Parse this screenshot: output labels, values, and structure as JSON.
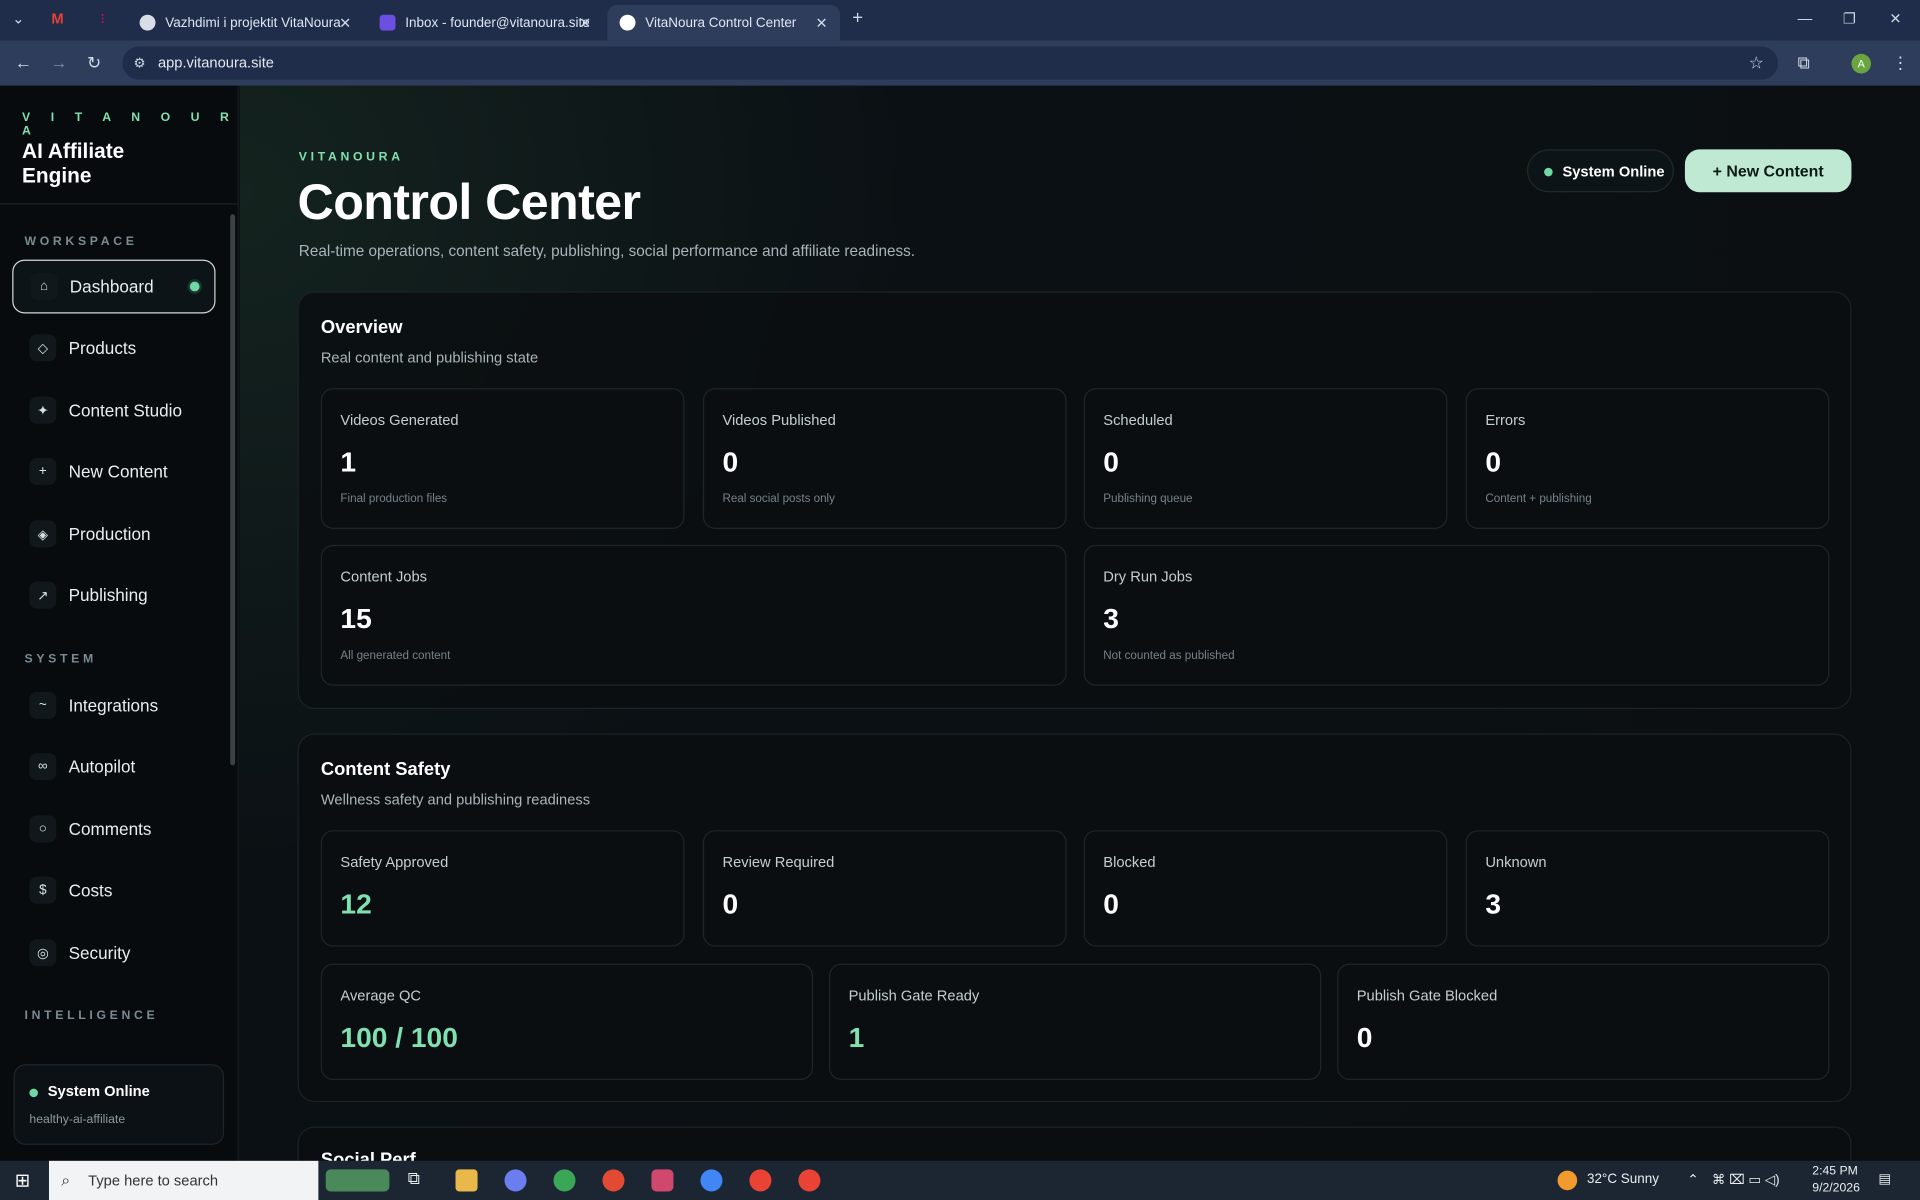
{
  "browser": {
    "tabs": [
      {
        "label": "Vazhdimi i projektit VitaNoura"
      },
      {
        "label": "Inbox - founder@vitanoura.site"
      },
      {
        "label": "VitaNoura Control Center"
      }
    ],
    "url": "app.vitanoura.site"
  },
  "sidebar": {
    "brand_small": "V I T A N O U R A",
    "brand_big": "AI Affiliate Engine",
    "section_workspace": "WORKSPACE",
    "section_system": "SYSTEM",
    "section_intelligence": "INTELLIGENCE",
    "workspace_items": [
      {
        "label": "Dashboard",
        "icon": "⌂"
      },
      {
        "label": "Products",
        "icon": "◇"
      },
      {
        "label": "Content Studio",
        "icon": "✦"
      },
      {
        "label": "New Content",
        "icon": "+"
      },
      {
        "label": "Production",
        "icon": "◈"
      },
      {
        "label": "Publishing",
        "icon": "↗"
      }
    ],
    "system_items": [
      {
        "label": "Integrations",
        "icon": "~"
      },
      {
        "label": "Autopilot",
        "icon": "∞"
      },
      {
        "label": "Comments",
        "icon": "○"
      },
      {
        "label": "Costs",
        "icon": "$"
      },
      {
        "label": "Security",
        "icon": "◎"
      }
    ],
    "status_title": "System Online",
    "status_sub": "healthy-ai-affiliate"
  },
  "header": {
    "eyebrow": "VITANOURA",
    "title": "Control Center",
    "subtitle": "Real-time operations, content safety, publishing, social performance and affiliate readiness.",
    "status_pill": "System Online",
    "new_button": "+ New Content"
  },
  "overview": {
    "title": "Overview",
    "subtitle": "Real content and publishing state",
    "cards": [
      {
        "label": "Videos Generated",
        "value": "1",
        "hint": "Final production files"
      },
      {
        "label": "Videos Published",
        "value": "0",
        "hint": "Real social posts only"
      },
      {
        "label": "Scheduled",
        "value": "0",
        "hint": "Publishing queue"
      },
      {
        "label": "Errors",
        "value": "0",
        "hint": "Content + publishing"
      },
      {
        "label": "Content Jobs",
        "value": "15",
        "hint": "All generated content"
      },
      {
        "label": "Dry Run Jobs",
        "value": "3",
        "hint": "Not counted as published"
      }
    ]
  },
  "safety": {
    "title": "Content Safety",
    "subtitle": "Wellness safety and publishing readiness",
    "cards": [
      {
        "label": "Safety Approved",
        "value": "12"
      },
      {
        "label": "Review Required",
        "value": "0"
      },
      {
        "label": "Blocked",
        "value": "0"
      },
      {
        "label": "Unknown",
        "value": "3"
      },
      {
        "label": "Average QC",
        "value": "100 / 100"
      },
      {
        "label": "Publish Gate Ready",
        "value": "1"
      },
      {
        "label": "Publish Gate Blocked",
        "value": "0"
      }
    ]
  },
  "next_section_partial": "Social Perf",
  "taskbar": {
    "search_placeholder": "Type here to search",
    "weather": "32°C  Sunny",
    "time": "2:45 PM",
    "date": "9/2/2026"
  }
}
